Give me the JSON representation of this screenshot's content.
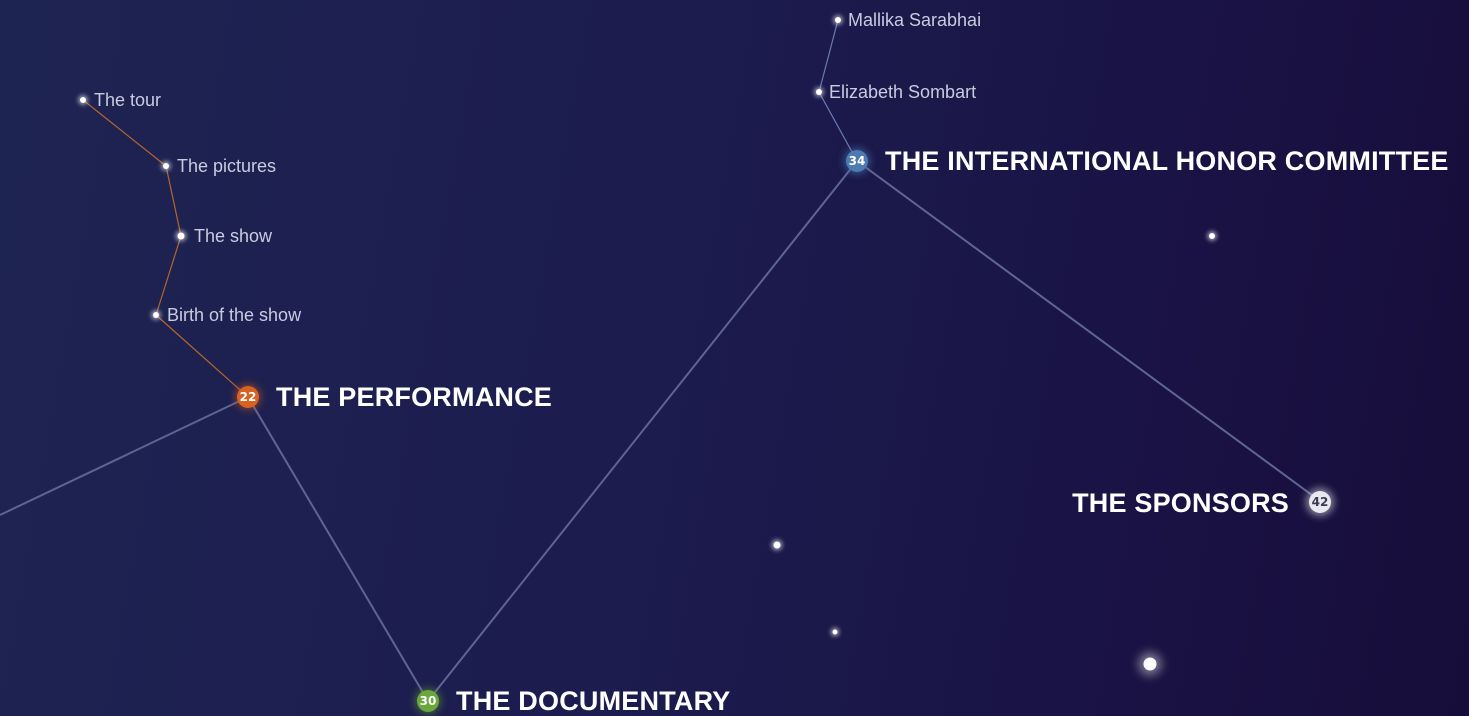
{
  "sections": {
    "performance": {
      "number": "22",
      "title": "THE PERFORMANCE",
      "accent": "#d8621f",
      "items": [
        "The tour",
        "The pictures",
        "The show",
        "Birth of the show"
      ]
    },
    "documentary": {
      "number": "30",
      "title": "THE DOCUMENTARY",
      "accent": "#6aa83c"
    },
    "honor_committee": {
      "number": "34",
      "title": "THE INTERNATIONAL HONOR COMMITTEE",
      "accent": "#4c7ab2",
      "items": [
        "Mallika Sarabhai",
        "Elizabeth Sombart"
      ]
    },
    "sponsors": {
      "number": "42",
      "title": "THE SPONSORS",
      "accent": "#e8e8ee"
    }
  },
  "colors": {
    "background_left": "#1e2452",
    "background_right": "#170d3a",
    "link_line": "#5f6592",
    "performance_link": "#b4652e"
  },
  "icons": [
    "star-icon",
    "section-badge"
  ]
}
